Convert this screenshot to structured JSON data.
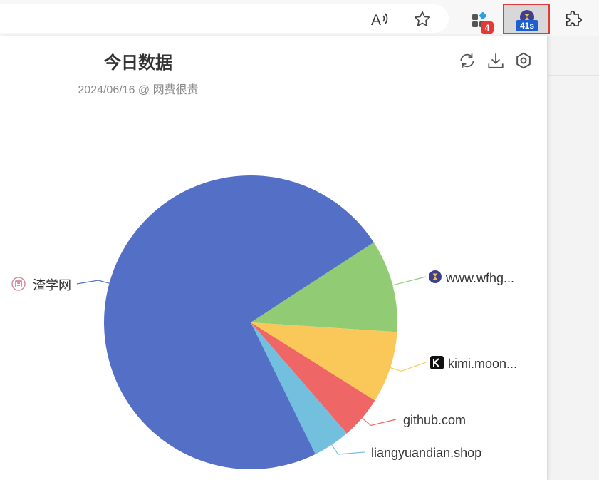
{
  "toolbar": {
    "ext_badge_count": "4",
    "timer_badge": "41s"
  },
  "popup": {
    "title": "今日数据",
    "subtitle": "2024/06/16 @ 网费很贵",
    "actions": {
      "refresh_icon": "refresh-icon",
      "download_icon": "download-icon",
      "settings_icon": "settings-icon"
    }
  },
  "chart_data": {
    "type": "pie",
    "categories": [
      "www.wfhg...",
      "kimi.moon...",
      "github.com",
      "liangyuandian.shop",
      "渣学网"
    ],
    "values": [
      10.2,
      7.9,
      4.7,
      4.1,
      73.1
    ],
    "colors": [
      "#91cc75",
      "#fac858",
      "#ee6666",
      "#73c0de",
      "#5470c6"
    ]
  }
}
